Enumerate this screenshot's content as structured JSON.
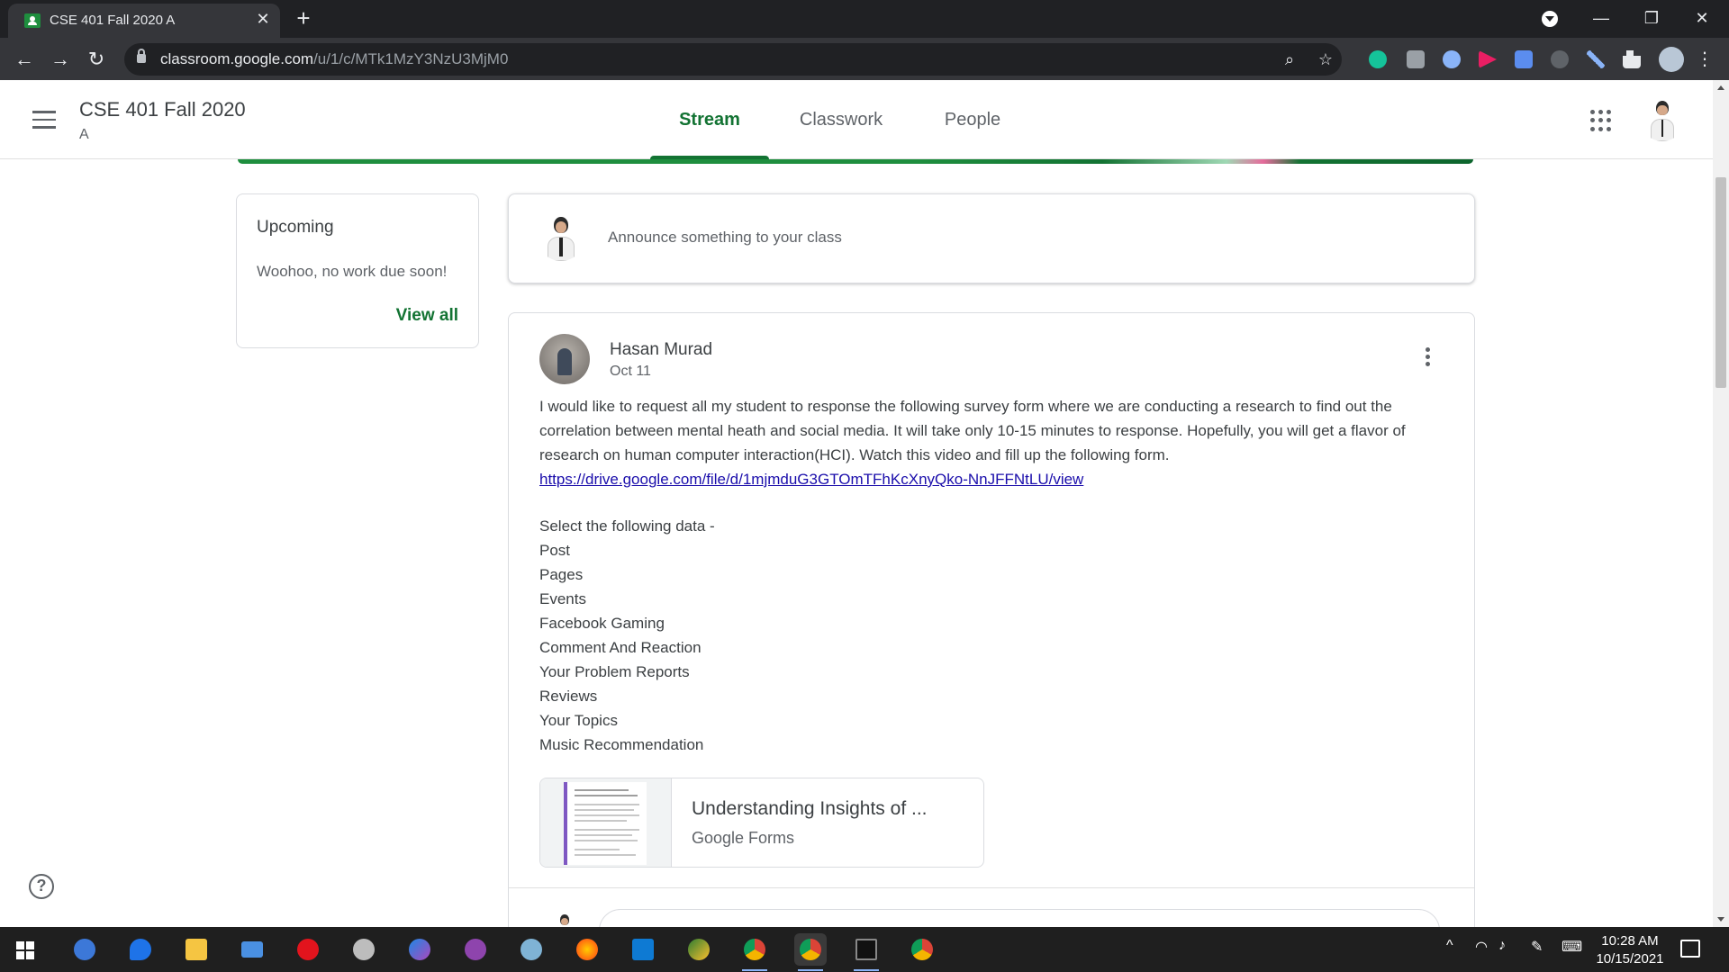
{
  "browser": {
    "tab_title": "CSE 401 Fall 2020 A",
    "tab_close": "✕",
    "new_tab": "+",
    "url_host": "classroom.google.com",
    "url_path": "/u/1/c/MTk1MzY3NzU3MjM0",
    "window_controls": {
      "minimize": "—",
      "restore": "❐",
      "close": "✕"
    },
    "icons": [
      "zoom-icon",
      "star-icon",
      "grammarly-icon",
      "camera-icon",
      "extension-icon",
      "play-icon",
      "download-icon",
      "extension-icon",
      "pen-icon",
      "puzzle-icon",
      "profile-icon",
      "menu-icon"
    ]
  },
  "classroom": {
    "course_title": "CSE 401 Fall 2020",
    "section": "A",
    "tabs": [
      {
        "label": "Stream",
        "active": true
      },
      {
        "label": "Classwork",
        "active": false
      },
      {
        "label": "People",
        "active": false
      }
    ],
    "accent_color": "#137333"
  },
  "upcoming": {
    "title": "Upcoming",
    "message": "Woohoo, no work due soon!",
    "view_all": "View all"
  },
  "announce": {
    "placeholder": "Announce something to your class"
  },
  "post": {
    "author": "Hasan Murad",
    "date": "Oct 11",
    "body": "I would like to request all my student to response the following survey form where we are conducting a research to find out the correlation between mental heath and social media. It will take only 10-15 minutes to response.  Hopefully, you will get a flavor of research on human computer interaction(HCI).   Watch this video and fill up the following form.",
    "link": "https://drive.google.com/file/d/1mjmduG3GTOmTFhKcXnyQko-NnJFFNtLU/view",
    "list_intro": "Select the following data -",
    "list_items": [
      "Post",
      "Pages",
      "Events",
      "Facebook Gaming",
      "Comment And Reaction",
      "Your Problem Reports",
      "Reviews",
      "Your Topics",
      "Music Recommendation"
    ],
    "attachment": {
      "title": "Understanding Insights of ...",
      "subtitle": "Google Forms"
    }
  },
  "help": {
    "label": "?"
  },
  "taskbar": {
    "apps": [
      "qbittorrent",
      "edge",
      "file-explorer",
      "mail",
      "opera",
      "satellite",
      "messenger",
      "github",
      "app",
      "firefox",
      "vscode",
      "app",
      "chrome",
      "chrome",
      "terminal",
      "chrome"
    ],
    "tray_icons": [
      "chevron-up-icon",
      "wifi-icon",
      "volume-icon",
      "pen-icon",
      "keyboard-icon"
    ],
    "time": "10:28 AM",
    "date": "10/15/2021"
  }
}
